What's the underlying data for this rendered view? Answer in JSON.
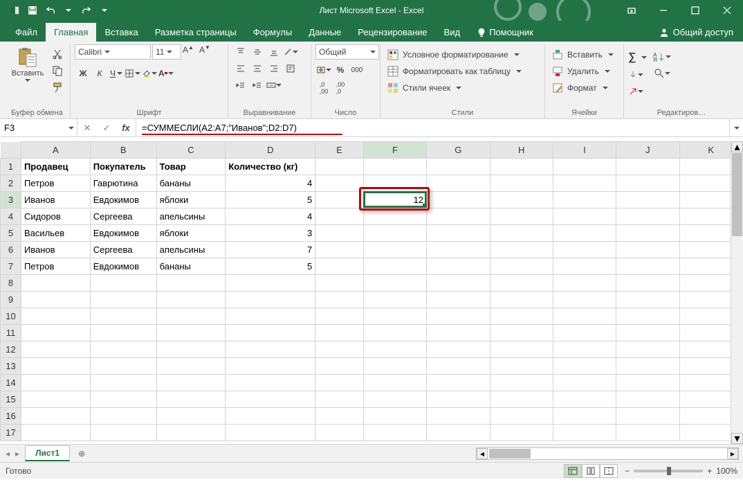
{
  "app": {
    "title": "Лист Microsoft Excel - Excel"
  },
  "tabs": {
    "file": "Файл",
    "home": "Главная",
    "insert": "Вставка",
    "page_layout": "Разметка страницы",
    "formulas": "Формулы",
    "data": "Данные",
    "review": "Рецензирование",
    "view": "Вид",
    "tell_me": "Помощник",
    "share": "Общий доступ"
  },
  "ribbon": {
    "clipboard": {
      "label": "Буфер обмена",
      "paste": "Вставить"
    },
    "font": {
      "label": "Шрифт",
      "name": "Calibri",
      "size": "11",
      "bold": "Ж",
      "italic": "К",
      "underline": "Ч"
    },
    "alignment": {
      "label": "Выравнивание"
    },
    "number": {
      "label": "Число",
      "format": "Общий"
    },
    "styles": {
      "label": "Стили",
      "cond": "Условное форматирование",
      "table": "Форматировать как таблицу",
      "cell": "Стили ячеек"
    },
    "cells": {
      "label": "Ячейки",
      "insert": "Вставить",
      "delete": "Удалить",
      "format": "Формат"
    },
    "editing": {
      "label": "Редактиров…"
    }
  },
  "namebox": "F3",
  "formula": "=СУММЕСЛИ(A2:A7;\"Иванов\";D2:D7)",
  "columns": [
    "A",
    "B",
    "C",
    "D",
    "E",
    "F",
    "G",
    "H",
    "I",
    "J",
    "K"
  ],
  "rows": [
    "1",
    "2",
    "3",
    "4",
    "5",
    "6",
    "7",
    "8",
    "9",
    "10",
    "11",
    "12",
    "13",
    "14",
    "15",
    "16",
    "17"
  ],
  "data": {
    "headers": [
      "Продавец",
      "Покупатель",
      "Товар",
      "Количество (кг)"
    ],
    "rows": [
      [
        "Петров",
        "Гаврютина",
        "бананы",
        "4"
      ],
      [
        "Иванов",
        "Евдокимов",
        "яблоки",
        "5"
      ],
      [
        "Сидоров",
        "Сергеева",
        "апельсины",
        "4"
      ],
      [
        "Васильев",
        "Евдокимов",
        "яблоки",
        "3"
      ],
      [
        "Иванов",
        "Сергеева",
        "апельсины",
        "7"
      ],
      [
        "Петров",
        "Евдокимов",
        "бананы",
        "5"
      ]
    ],
    "result_cell": "12"
  },
  "sheet": {
    "name": "Лист1"
  },
  "status": {
    "ready": "Готово",
    "zoom": "100%"
  }
}
